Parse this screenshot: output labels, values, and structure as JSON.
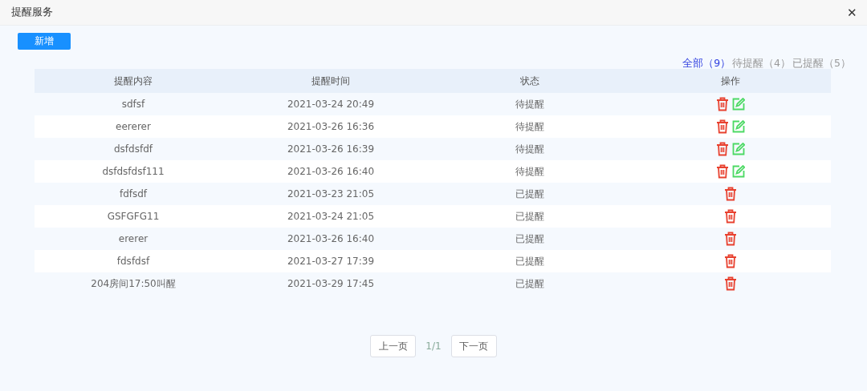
{
  "window": {
    "title": "提醒服务",
    "close": "✕"
  },
  "add_button": "新增",
  "filters": [
    {
      "label": "全部（9）",
      "selected": true
    },
    {
      "label": "待提醒（4）",
      "selected": false
    },
    {
      "label": "已提醒（5）",
      "selected": false
    }
  ],
  "table": {
    "columns": [
      "提醒内容",
      "提醒时间",
      "状态",
      "操作"
    ],
    "rows": [
      {
        "content": "sdfsf",
        "time": "2021-03-24 20:49",
        "status": "待提醒",
        "editable": true
      },
      {
        "content": "eererer",
        "time": "2021-03-26 16:36",
        "status": "待提醒",
        "editable": true
      },
      {
        "content": "dsfdsfdf",
        "time": "2021-03-26 16:39",
        "status": "待提醒",
        "editable": true
      },
      {
        "content": "dsfdsfdsf111",
        "time": "2021-03-26 16:40",
        "status": "待提醒",
        "editable": true
      },
      {
        "content": "fdfsdf",
        "time": "2021-03-23 21:05",
        "status": "已提醒",
        "editable": false
      },
      {
        "content": "GSFGFG11",
        "time": "2021-03-24 21:05",
        "status": "已提醒",
        "editable": false
      },
      {
        "content": "ererer",
        "time": "2021-03-26 16:40",
        "status": "已提醒",
        "editable": false
      },
      {
        "content": "fdsfdsf",
        "time": "2021-03-27 17:39",
        "status": "已提醒",
        "editable": false
      },
      {
        "content": "204房间17:50叫醒",
        "time": "2021-03-29 17:45",
        "status": "已提醒",
        "editable": false
      }
    ]
  },
  "pagination": {
    "prev": "上一页",
    "page": "1/1",
    "next": "下一页"
  }
}
